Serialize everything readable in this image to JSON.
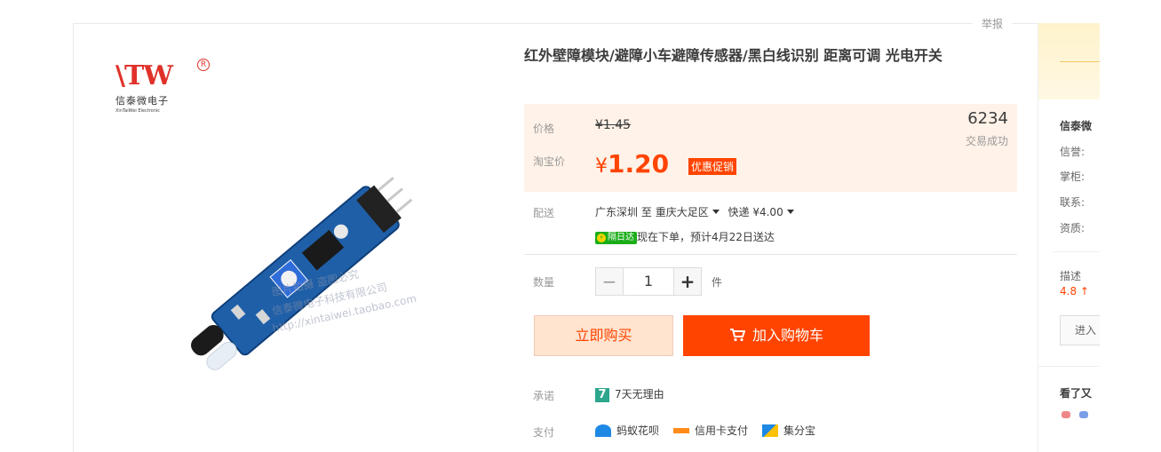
{
  "page": {
    "report_link": "举报"
  },
  "product": {
    "title": "红外壁障模块/避障小车避障传感器/黑白线识别 距离可调 光电开关",
    "image": {
      "logo_mark": "TW",
      "logo_reg": "R",
      "logo_cn": "信泰微电子",
      "logo_en": "XinTaiWei Electronic",
      "watermarks": [
        "图片拍摄 盗图必究",
        "信泰微电子科技有限公司",
        "http://xintaiwei.taobao.com"
      ]
    }
  },
  "price": {
    "price_label": "价格",
    "original": "¥1.45",
    "taobao_label": "淘宝价",
    "currency": "¥",
    "sale": "1.20",
    "promo_tag": "优惠促销",
    "sold_count": "6234",
    "sold_label": "交易成功",
    "colors": {
      "accent": "#ff4400",
      "price_bg": "#fff2e8"
    }
  },
  "shipping": {
    "label": "配送",
    "from": "广东深圳",
    "to_word": "至",
    "to": "重庆大足区",
    "method": "快递 ¥4.00",
    "nextday_badge": "隔日达",
    "eta": "现在下单，预计4月22日送达"
  },
  "quantity": {
    "label": "数量",
    "minus": "−",
    "value": "1",
    "plus": "+",
    "unit": "件"
  },
  "actions": {
    "buy_now": "立即购买",
    "add_to_cart": "加入购物车"
  },
  "promise": {
    "label": "承诺",
    "icon_text": "7",
    "text": "7天无理由"
  },
  "payment": {
    "label": "支付",
    "methods": [
      {
        "name": "蚂蚁花呗",
        "icon": "huabei-icon"
      },
      {
        "name": "信用卡支付",
        "icon": "credit-card-icon"
      },
      {
        "name": "集分宝",
        "icon": "jifenbao-icon"
      }
    ]
  },
  "seller": {
    "name": "信泰微",
    "fields": [
      "信誉:",
      "掌柜:",
      "联系:",
      "资质:"
    ],
    "desc_label": "描述",
    "desc_score": "4.8 ↑",
    "enter_shop": "进入",
    "also_viewed": "看了又"
  }
}
